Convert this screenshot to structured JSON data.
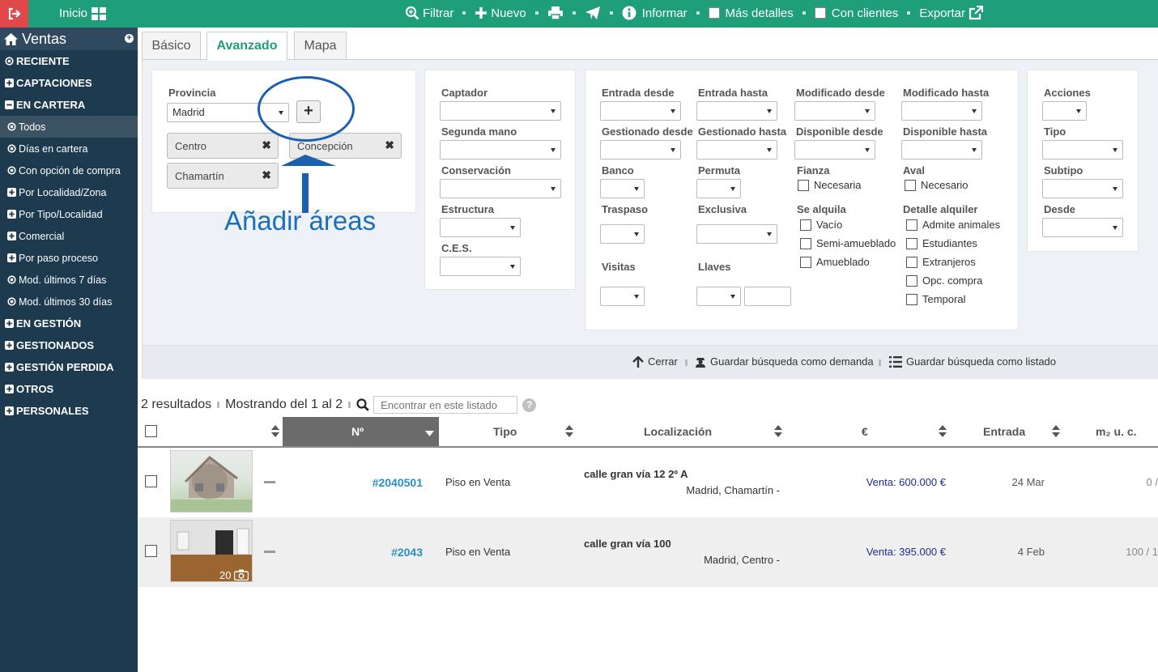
{
  "topbar": {
    "home_label": "Inicio",
    "actions": {
      "filtrar": "Filtrar",
      "nuevo": "Nuevo",
      "informar": "Informar",
      "mas_detalles": "Más detalles",
      "con_clientes": "Con clientes",
      "exportar": "Exportar"
    },
    "colors": {
      "bar": "#1f9e7a",
      "exit": "#e0484b"
    }
  },
  "sidebar": {
    "title": "Ventas",
    "items": [
      {
        "label": "RECIENTE",
        "icon": "circle-dot-icon"
      },
      {
        "label": "CAPTACIONES",
        "icon": "plus-square-icon"
      },
      {
        "label": "EN CARTERA",
        "icon": "minus-square-icon"
      },
      {
        "label": "Todos",
        "icon": "circle-dot-icon",
        "active": true
      },
      {
        "label": "Días en cartera",
        "icon": "circle-dot-icon"
      },
      {
        "label": "Con opción de compra",
        "icon": "circle-dot-icon"
      },
      {
        "label": "Por Localidad/Zona",
        "icon": "plus-square-icon"
      },
      {
        "label": "Por Tipo/Localidad",
        "icon": "plus-square-icon"
      },
      {
        "label": "Comercial",
        "icon": "plus-square-icon"
      },
      {
        "label": "Por paso proceso",
        "icon": "plus-square-icon"
      },
      {
        "label": "Mod. últimos 7 días",
        "icon": "circle-dot-icon"
      },
      {
        "label": "Mod. últimos 30 días",
        "icon": "circle-dot-icon"
      },
      {
        "label": "EN GESTIÓN",
        "icon": "plus-square-icon"
      },
      {
        "label": "GESTIONADOS",
        "icon": "plus-square-icon"
      },
      {
        "label": "GESTIÓN PERDIDA",
        "icon": "plus-square-icon"
      },
      {
        "label": "OTROS",
        "icon": "plus-square-icon"
      },
      {
        "label": "PERSONALES",
        "icon": "plus-square-icon"
      }
    ]
  },
  "tabs": [
    "Básico",
    "Avanzado",
    "Mapa"
  ],
  "filters": {
    "provincia_label": "Provincia",
    "provincia_value": "Madrid",
    "add_button": "+",
    "areas": [
      "Centro",
      "Concepción",
      "Chamartín"
    ],
    "annotation": "Añadir áreas",
    "col2": [
      "Captador",
      "Segunda mano",
      "Conservación",
      "Estructura",
      "C.E.S."
    ],
    "col3": {
      "entrada_desde": "Entrada desde",
      "entrada_hasta": "Entrada hasta",
      "modificado_desde": "Modificado desde",
      "modificado_hasta": "Modificado hasta",
      "gestionado_desde": "Gestionado desde",
      "gestionado_hasta": "Gestionado hasta",
      "disponible_desde": "Disponible desde",
      "disponible_hasta": "Disponible hasta",
      "banco": "Banco",
      "permuta": "Permuta",
      "fianza": "Fianza",
      "fianza_opt": "Necesaria",
      "aval": "Aval",
      "aval_opt": "Necesario",
      "traspaso": "Traspaso",
      "exclusiva": "Exclusiva",
      "se_alquila": "Se alquila",
      "se_alquila_opts": [
        "Vacío",
        "Semi-amueblado",
        "Amueblado"
      ],
      "detalle_alquiler": "Detalle alquiler",
      "detalle_opts": [
        "Admite animales",
        "Estudiantes",
        "Extranjeros",
        "Opc. compra",
        "Temporal"
      ],
      "visitas": "Visitas",
      "llaves": "Llaves"
    },
    "col4": [
      "Acciones",
      "Tipo",
      "Subtipo",
      "Desde"
    ],
    "bottom": {
      "cerrar": "Cerrar",
      "guardar_demanda": "Guardar búsqueda como demanda",
      "guardar_listado": "Guardar búsqueda como listado"
    }
  },
  "results": {
    "count": "2 resultados",
    "showing": "Mostrando del 1 al 2",
    "search_placeholder": "Encontrar en este listado",
    "help": "?",
    "columns": {
      "num": "Nº",
      "tipo": "Tipo",
      "localizacion": "Localización",
      "price": "€",
      "entrada": "Entrada",
      "m2": "m₂ u. c."
    },
    "rows": [
      {
        "ref": "#2040501",
        "tipo": "Piso en Venta",
        "street": "calle gran vía 12 2º A",
        "area": "Madrid, Chamartín -",
        "price": "Venta: 600.000 €",
        "entrada": "24 Mar",
        "m2": "0 /"
      },
      {
        "ref": "#2043",
        "tipo": "Piso en Venta",
        "street": "calle gran vía 100",
        "area": "Madrid, Centro -",
        "price": "Venta: 395.000 €",
        "entrada": "4 Feb",
        "m2": "100 / 1",
        "photos": "20"
      }
    ]
  }
}
